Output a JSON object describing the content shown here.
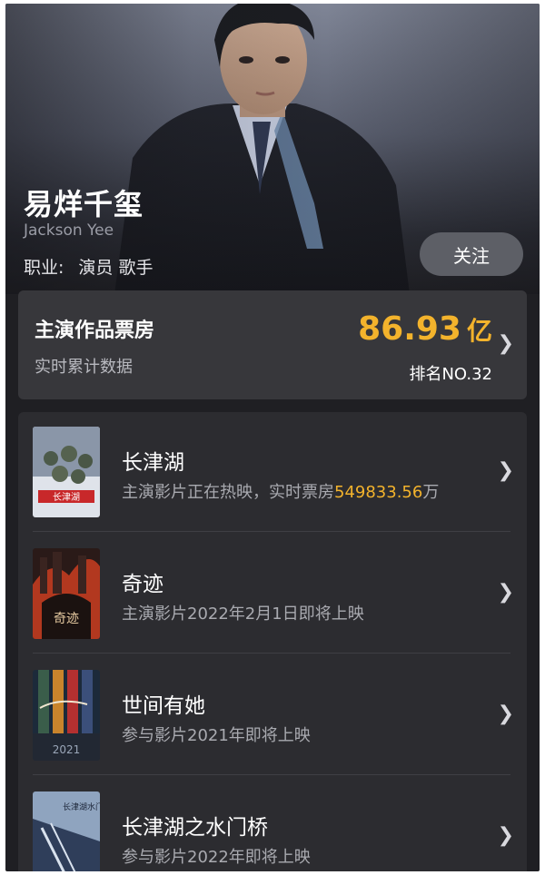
{
  "profile": {
    "name": "易烊千玺",
    "english_name": "Jackson Yee",
    "job_label": "职业:",
    "jobs": [
      "演员",
      "歌手"
    ],
    "follow_label": "关注"
  },
  "box_office": {
    "title": "主演作品票房",
    "subtitle": "实时累计数据",
    "amount": "86.93",
    "unit": "亿",
    "rank": "排名NO.32",
    "accent_color": "#f3b32c"
  },
  "films": [
    {
      "title": "长津湖",
      "sub_prefix": "主演影片正在热映，实时票房",
      "sub_highlight": "549833.56",
      "sub_suffix": "万",
      "poster_text": "长津湖"
    },
    {
      "title": "奇迹",
      "sub_prefix": "主演影片2022年2月1日即将上映",
      "sub_highlight": "",
      "sub_suffix": "",
      "poster_text": "奇迹"
    },
    {
      "title": "世间有她",
      "sub_prefix": "参与影片2021年即将上映",
      "sub_highlight": "",
      "sub_suffix": "",
      "poster_text": "2021"
    },
    {
      "title": "长津湖之水门桥",
      "sub_prefix": "参与影片2022年即将上映",
      "sub_highlight": "",
      "sub_suffix": "",
      "poster_text": "长津湖水门桥"
    }
  ],
  "icons": {
    "chevron": "chevron-right-icon"
  }
}
